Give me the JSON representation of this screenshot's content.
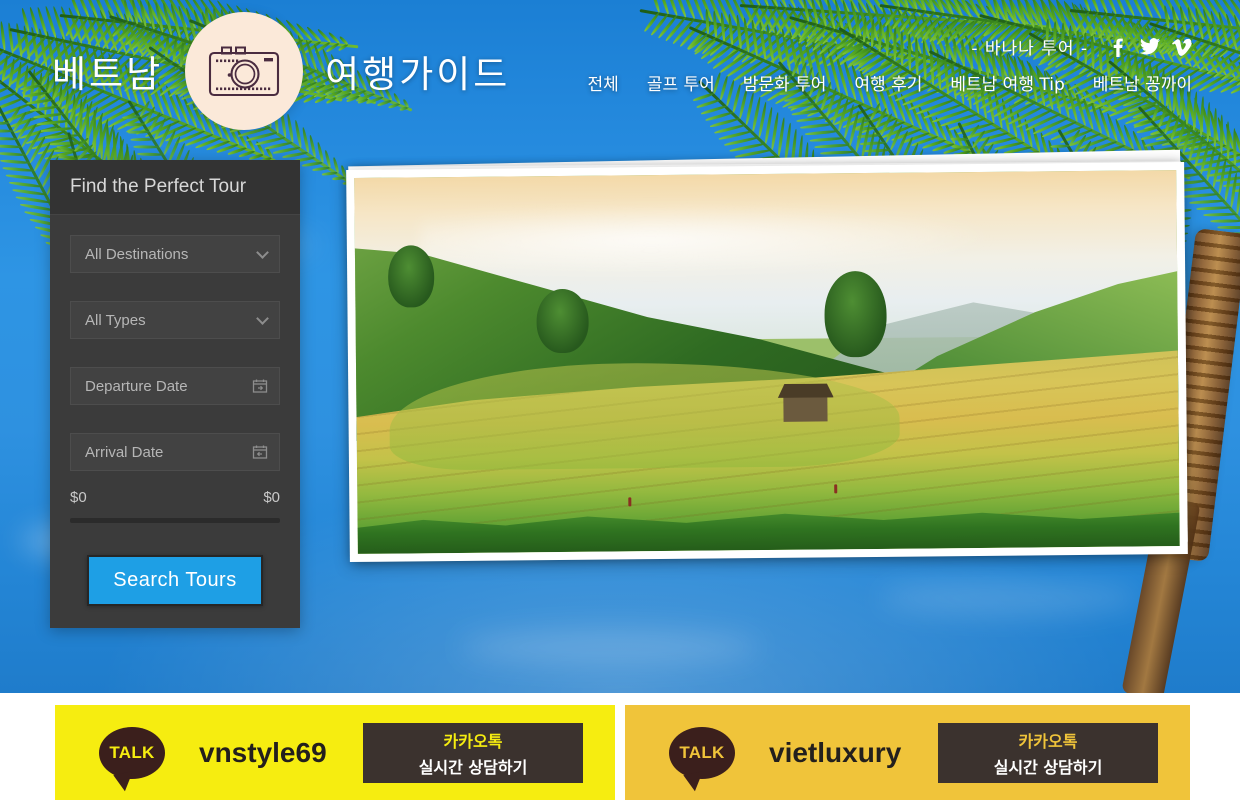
{
  "header": {
    "brand_left": "베트남",
    "brand_right": "여행가이드",
    "logo_icon": "camera-icon",
    "partner_label": "- 바나나 투어 -",
    "social": [
      {
        "name": "facebook-icon",
        "glyph": "f"
      },
      {
        "name": "twitter-icon",
        "glyph": "🐦"
      },
      {
        "name": "vimeo-icon",
        "glyph": "v"
      }
    ],
    "nav": [
      {
        "label": "전체"
      },
      {
        "label": "골프 투어"
      },
      {
        "label": "밤문화 투어"
      },
      {
        "label": "여행 후기"
      },
      {
        "label": "베트남 여행 Tip"
      },
      {
        "label": "베트남 꽁까이"
      }
    ]
  },
  "search_panel": {
    "title": "Find the Perfect Tour",
    "destination": {
      "value": "All Destinations",
      "icon": "chevron-down-icon"
    },
    "type": {
      "value": "All Types",
      "icon": "chevron-down-icon"
    },
    "departure": {
      "placeholder": "Departure Date",
      "icon": "calendar-icon"
    },
    "arrival": {
      "placeholder": "Arrival Date",
      "icon": "calendar-icon"
    },
    "price_min": "$0",
    "price_max": "$0",
    "search_button": "Search  Tours"
  },
  "hero": {
    "photo_alt": "vietnam-terraced-rice-fields"
  },
  "banners": [
    {
      "id_label": "vnstyle69",
      "talk_label": "TALK",
      "cta_line1": "카카오톡",
      "cta_line2": "실시간 상담하기",
      "bg_color": "#f6ed10"
    },
    {
      "id_label": "vietluxury",
      "talk_label": "TALK",
      "cta_line1": "카카오톡",
      "cta_line2": "실시간 상담하기",
      "bg_color": "#f0c43a"
    }
  ],
  "colors": {
    "accent_blue": "#1e9fe5",
    "panel_bg": "#3b3b3b",
    "panel_head": "#333333",
    "logo_circle": "#fbe9d9",
    "sky_blue": "#2e91e0"
  }
}
